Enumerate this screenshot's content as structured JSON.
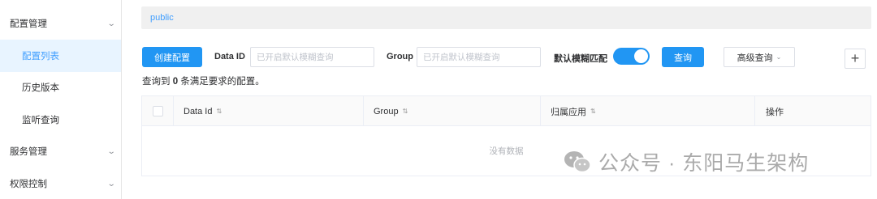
{
  "sidebar": {
    "groups": [
      {
        "label": "配置管理",
        "items": [
          "配置列表",
          "历史版本",
          "监听查询"
        ]
      },
      {
        "label": "服务管理"
      },
      {
        "label": "权限控制"
      }
    ],
    "active_item": "配置列表"
  },
  "namespace": {
    "label": "public"
  },
  "toolbar": {
    "create_label": "创建配置",
    "data_id_label": "Data ID",
    "data_id_placeholder": "已开启默认模糊查询",
    "group_label": "Group",
    "group_placeholder": "已开启默认模糊查询",
    "fuzzy_label": "默认模糊匹配",
    "fuzzy_enabled": true,
    "search_label": "查询",
    "advanced_label": "高级查询",
    "add_icon": "plus-icon"
  },
  "result": {
    "prefix": "查询到",
    "count": "0",
    "suffix": "条满足要求的配置。"
  },
  "table": {
    "columns": [
      "Data Id",
      "Group",
      "归属应用",
      "操作"
    ],
    "empty_text": "没有数据"
  },
  "watermark": {
    "text": "公众号 · 东阳马生架构"
  },
  "colors": {
    "accent": "#2196f3",
    "active_bg": "#e8f4ff",
    "link": "#409eff"
  }
}
